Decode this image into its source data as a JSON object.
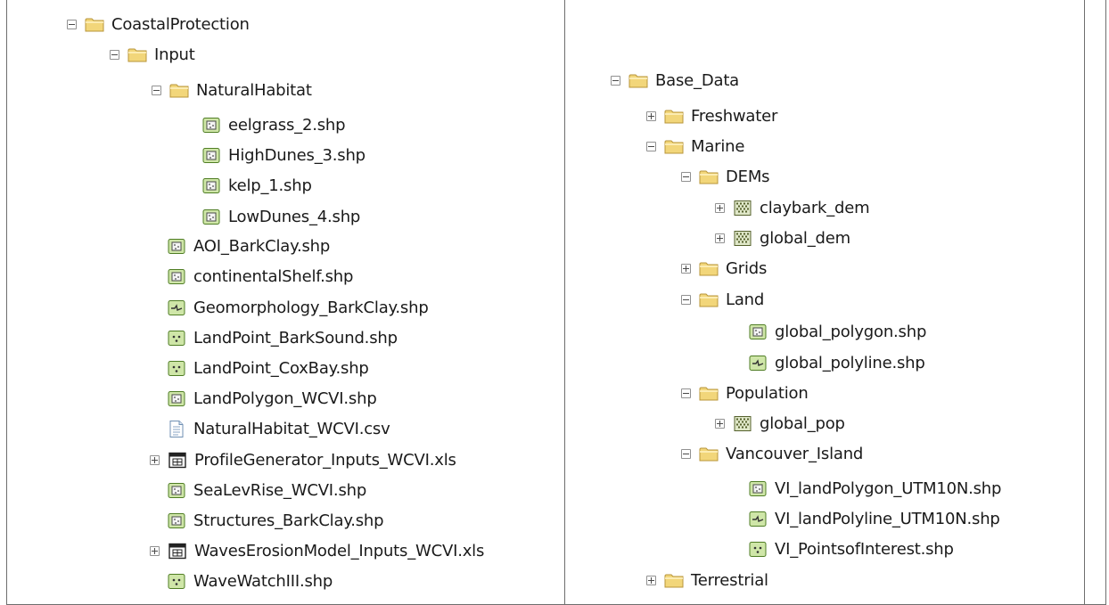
{
  "left_tree": [
    {
      "label": "CoastalProtection",
      "icon": "folder-icon",
      "toggle": "minus"
    },
    {
      "label": "Input",
      "icon": "folder-icon",
      "toggle": "minus"
    },
    {
      "label": "NaturalHabitat",
      "icon": "folder-icon",
      "toggle": "minus"
    },
    {
      "label": "eelgrass_2.shp",
      "icon": "polygon-shapefile-icon",
      "toggle": "none"
    },
    {
      "label": "HighDunes_3.shp",
      "icon": "polygon-shapefile-icon",
      "toggle": "none"
    },
    {
      "label": "kelp_1.shp",
      "icon": "polygon-shapefile-icon",
      "toggle": "none"
    },
    {
      "label": "LowDunes_4.shp",
      "icon": "polygon-shapefile-icon",
      "toggle": "none"
    },
    {
      "label": "AOI_BarkClay.shp",
      "icon": "polygon-shapefile-icon",
      "toggle": "none"
    },
    {
      "label": "continentalShelf.shp",
      "icon": "polygon-shapefile-icon",
      "toggle": "none"
    },
    {
      "label": "Geomorphology_BarkClay.shp",
      "icon": "polyline-shapefile-icon",
      "toggle": "none"
    },
    {
      "label": "LandPoint_BarkSound.shp",
      "icon": "point-shapefile-icon",
      "toggle": "none"
    },
    {
      "label": "LandPoint_CoxBay.shp",
      "icon": "point-shapefile-icon",
      "toggle": "none"
    },
    {
      "label": "LandPolygon_WCVI.shp",
      "icon": "polygon-shapefile-icon",
      "toggle": "none"
    },
    {
      "label": "NaturalHabitat_WCVI.csv",
      "icon": "text-file-icon",
      "toggle": "none"
    },
    {
      "label": "ProfileGenerator_Inputs_WCVI.xls",
      "icon": "excel-table-icon",
      "toggle": "plus"
    },
    {
      "label": "SeaLevRise_WCVI.shp",
      "icon": "polygon-shapefile-icon",
      "toggle": "none"
    },
    {
      "label": "Structures_BarkClay.shp",
      "icon": "polygon-shapefile-icon",
      "toggle": "none"
    },
    {
      "label": "WavesErosionModel_Inputs_WCVI.xls",
      "icon": "excel-table-icon",
      "toggle": "plus"
    },
    {
      "label": "WaveWatchIII.shp",
      "icon": "point-shapefile-icon",
      "toggle": "none"
    }
  ],
  "right_tree": [
    {
      "label": "Base_Data",
      "icon": "folder-icon",
      "toggle": "minus"
    },
    {
      "label": "Freshwater",
      "icon": "folder-icon",
      "toggle": "plus"
    },
    {
      "label": "Marine",
      "icon": "folder-icon",
      "toggle": "minus"
    },
    {
      "label": "DEMs",
      "icon": "folder-icon",
      "toggle": "minus"
    },
    {
      "label": "claybark_dem",
      "icon": "raster-icon",
      "toggle": "plus"
    },
    {
      "label": "global_dem",
      "icon": "raster-icon",
      "toggle": "plus"
    },
    {
      "label": "Grids",
      "icon": "folder-icon",
      "toggle": "plus"
    },
    {
      "label": "Land",
      "icon": "folder-icon",
      "toggle": "minus"
    },
    {
      "label": "global_polygon.shp",
      "icon": "polygon-shapefile-icon",
      "toggle": "none"
    },
    {
      "label": "global_polyline.shp",
      "icon": "polyline-shapefile-icon",
      "toggle": "none"
    },
    {
      "label": "Population",
      "icon": "folder-icon",
      "toggle": "minus"
    },
    {
      "label": "global_pop",
      "icon": "raster-icon",
      "toggle": "plus"
    },
    {
      "label": "Vancouver_Island",
      "icon": "folder-icon",
      "toggle": "minus"
    },
    {
      "label": "VI_landPolygon_UTM10N.shp",
      "icon": "polygon-shapefile-icon",
      "toggle": "none"
    },
    {
      "label": "VI_landPolyline_UTM10N.shp",
      "icon": "polyline-shapefile-icon",
      "toggle": "none"
    },
    {
      "label": "VI_PointsofInterest.shp",
      "icon": "point-shapefile-icon",
      "toggle": "none"
    },
    {
      "label": "Terrestrial",
      "icon": "folder-icon",
      "toggle": "plus"
    }
  ],
  "colors": {
    "folder": "#f2d67a",
    "folder_edge": "#b8953a",
    "shapefile_fill": "#cfe6a8",
    "shapefile_edge": "#4f7d24",
    "border": "#6e6e6e"
  }
}
